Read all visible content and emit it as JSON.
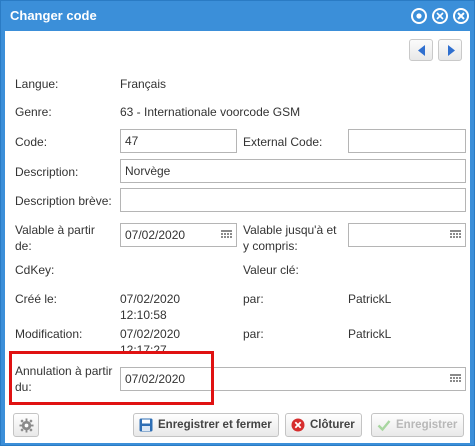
{
  "window": {
    "title": "Changer code",
    "colors": {
      "titlebar": "#3b8fd9",
      "highlight": "#e01212"
    }
  },
  "titlebar_icons": [
    "help-icon",
    "restore-icon",
    "close-icon"
  ],
  "nav": {
    "prev_icon": "arrow-left-icon",
    "next_icon": "arrow-right-icon"
  },
  "form": {
    "langue": {
      "label": "Langue:",
      "value": "Français"
    },
    "genre": {
      "label": "Genre:",
      "value": "63 - Internationale voorcode GSM"
    },
    "code": {
      "label": "Code:",
      "value": "47"
    },
    "external_code": {
      "label": "External Code:",
      "value": ""
    },
    "description": {
      "label": "Description:",
      "value": "Norvège"
    },
    "description_breve": {
      "label": "Description brève:",
      "value": ""
    },
    "valable_a_partir": {
      "label_line1": "Valable à partir",
      "label_line2": "de:",
      "value": "07/02/2020"
    },
    "valable_jusqua": {
      "label_line1": "Valable jusqu'à et",
      "label_line2": "y compris:",
      "value": ""
    },
    "cdkey": {
      "label": "CdKey:"
    },
    "valeur_cle": {
      "label": "Valeur clé:"
    },
    "cree_le": {
      "label": "Créé le:",
      "date": "07/02/2020",
      "time": "12:10:58",
      "par_label": "par:",
      "par_value": "PatrickL"
    },
    "modification": {
      "label": "Modification:",
      "date": "07/02/2020",
      "time": "12:17:27",
      "par_label": "par:",
      "par_value": "PatrickL"
    },
    "annulation": {
      "label_line1": "Annulation à partir",
      "label_line2": "du:",
      "value": "07/02/2020"
    }
  },
  "footer": {
    "settings_icon": "gear-icon",
    "save_close_label": "Enregistrer et fermer",
    "close_label": "Clôturer",
    "save_label": "Enregistrer"
  }
}
